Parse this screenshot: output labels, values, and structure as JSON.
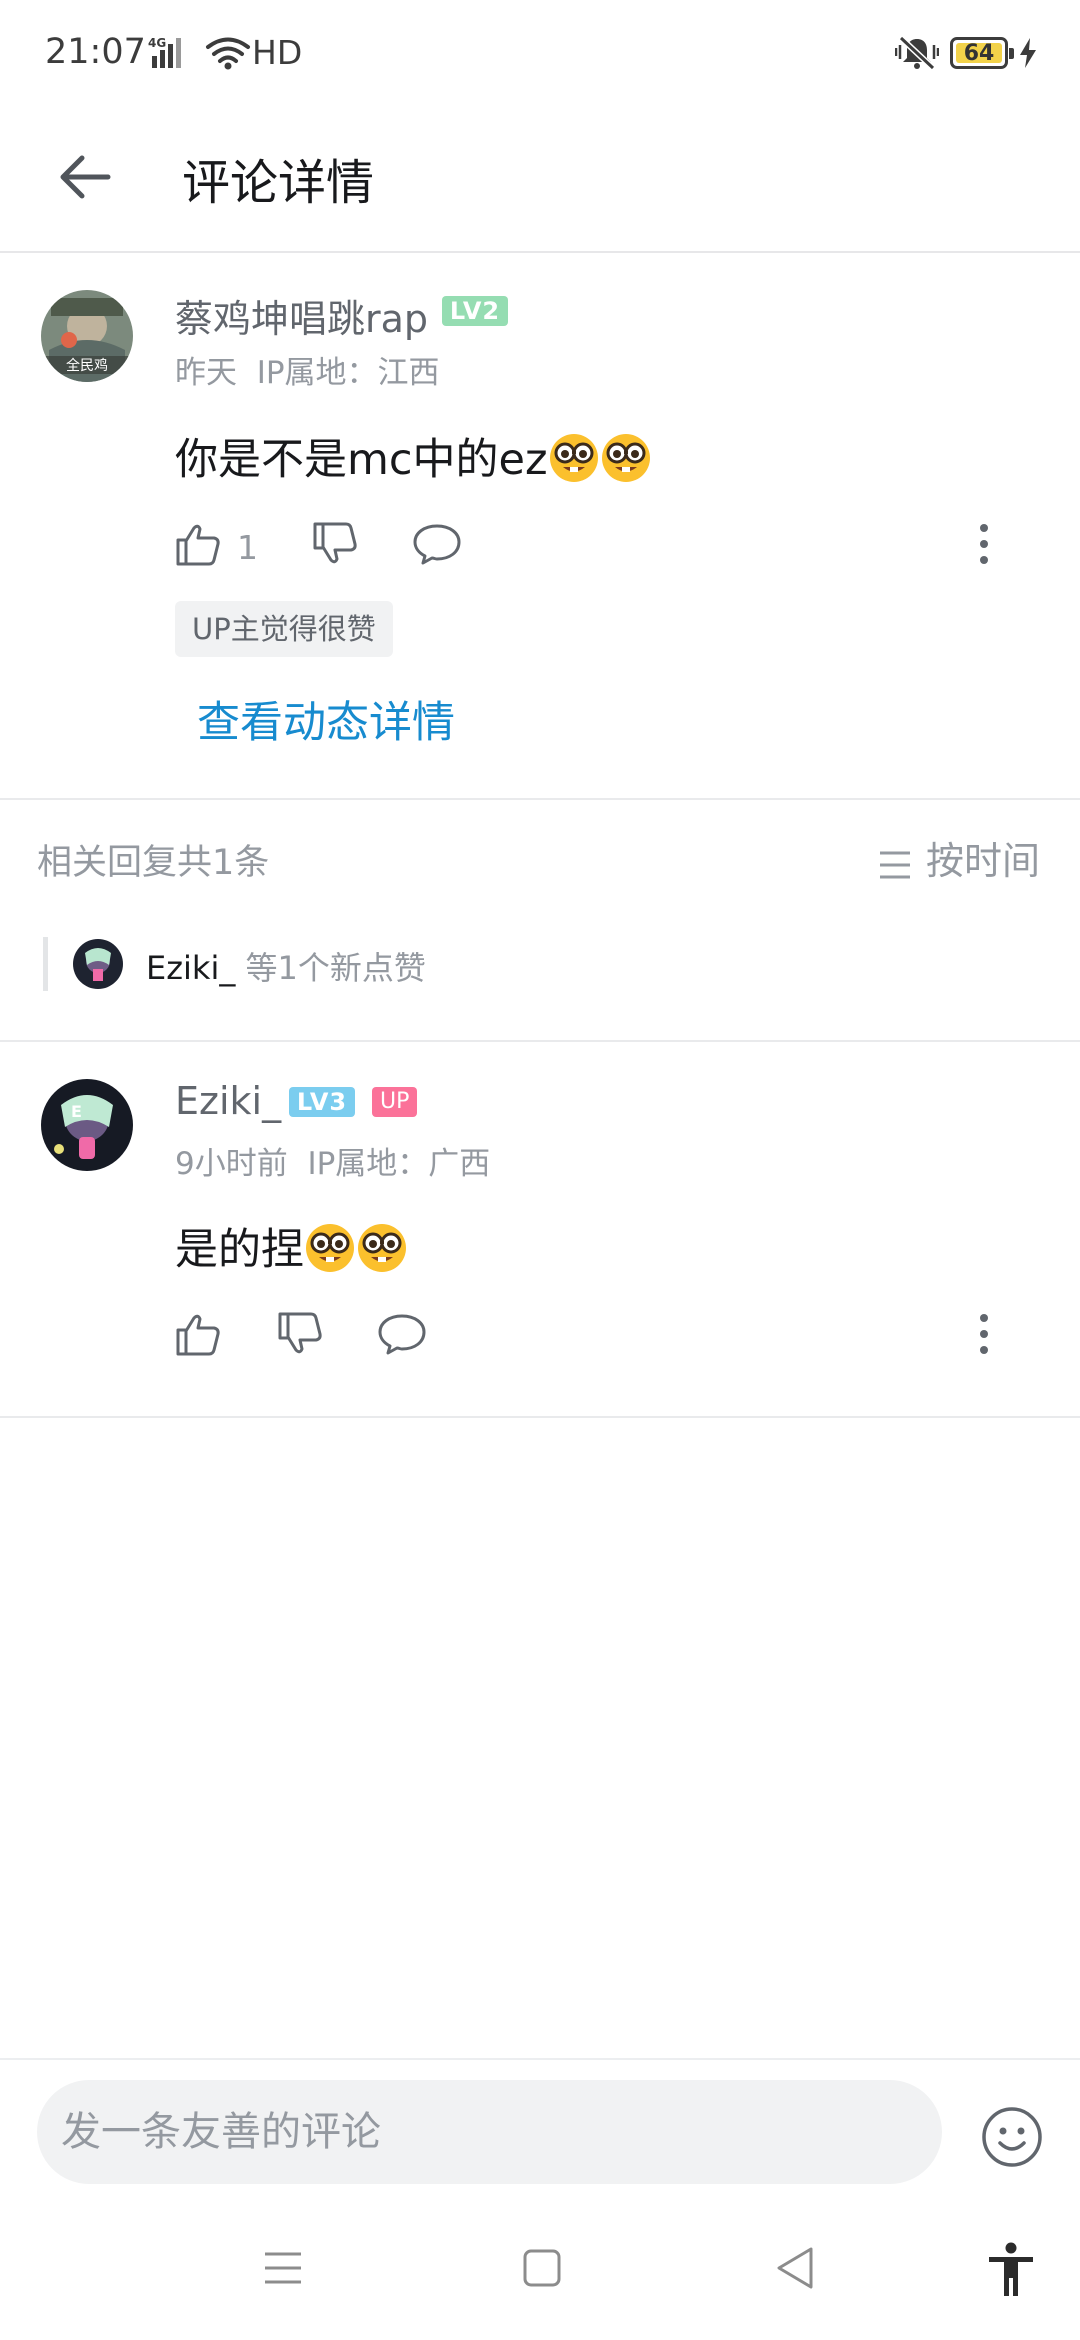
{
  "status_bar": {
    "time": "21:07",
    "network": "4G",
    "hd": "HD",
    "battery": "64"
  },
  "header": {
    "title": "评论详情",
    "back_icon": "arrow-left-icon"
  },
  "main_comment": {
    "username": "蔡鸡坤唱跳rap",
    "level": "LV2",
    "level_color": "#95ddb2",
    "time": "昨天",
    "ip": "IP属地：江西",
    "text": "你是不是mc中的ez",
    "emoji": "nerd-face-emoji",
    "like_count": "1",
    "up_liked_label": "UP主觉得很赞",
    "view_detail_label": "查看动态详情"
  },
  "replies_header": {
    "count_label": "相关回复共1条",
    "sort_label": "按时间"
  },
  "likes_summary": {
    "user": "Eziki_",
    "suffix": "等1个新点赞"
  },
  "reply": {
    "username": "Eziki_",
    "level": "LV3",
    "level_color": "#7bcdef",
    "up_badge": "UP",
    "time": "9小时前",
    "ip": "IP属地：广西",
    "text": "是的捏"
  },
  "input_bar": {
    "placeholder": "发一条友善的评论"
  },
  "colors": {
    "accent_link": "#178bcf",
    "up_badge": "#fb7299",
    "battery": "#f2d24a"
  }
}
